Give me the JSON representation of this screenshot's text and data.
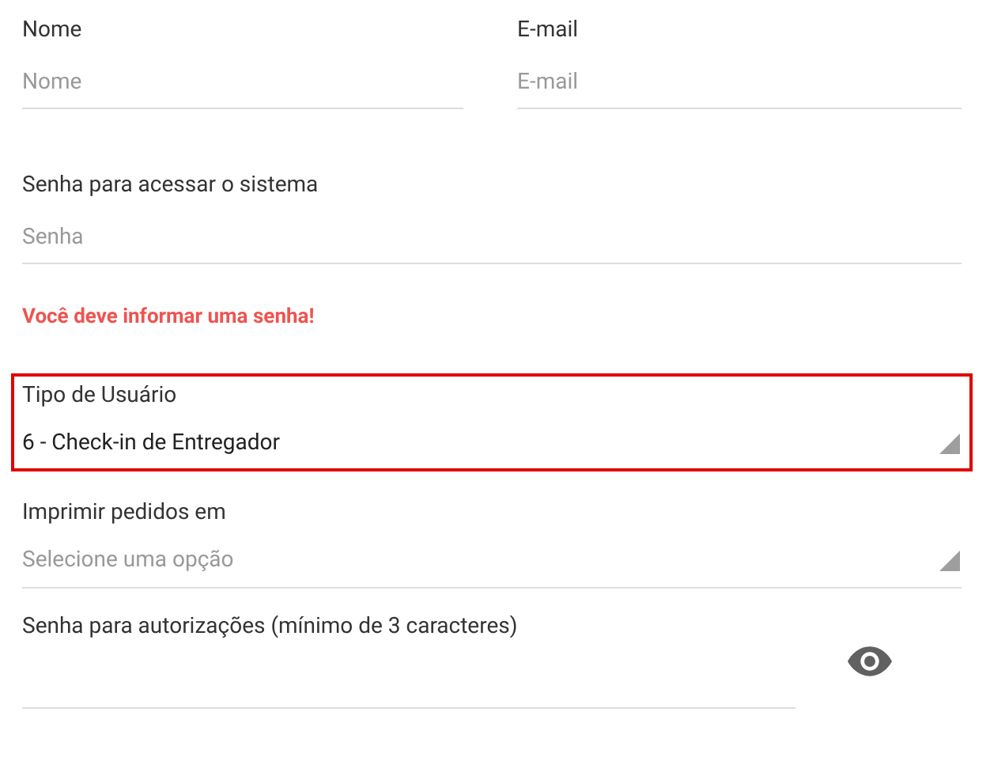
{
  "name_field": {
    "label": "Nome",
    "placeholder": "Nome"
  },
  "email_field": {
    "label": "E-mail",
    "placeholder": "E-mail"
  },
  "password_field": {
    "label": "Senha para acessar o sistema",
    "placeholder": "Senha"
  },
  "error": "Você deve informar uma senha!",
  "user_type": {
    "label": "Tipo de Usuário",
    "value": "6 - Check-in de Entregador",
    "highlighted": true
  },
  "print_orders": {
    "label": "Imprimir pedidos em",
    "placeholder": "Selecione uma opção",
    "highlighted": false
  },
  "auth_password": {
    "label": "Senha para autorizações (mínimo de 3 caracteres)"
  }
}
